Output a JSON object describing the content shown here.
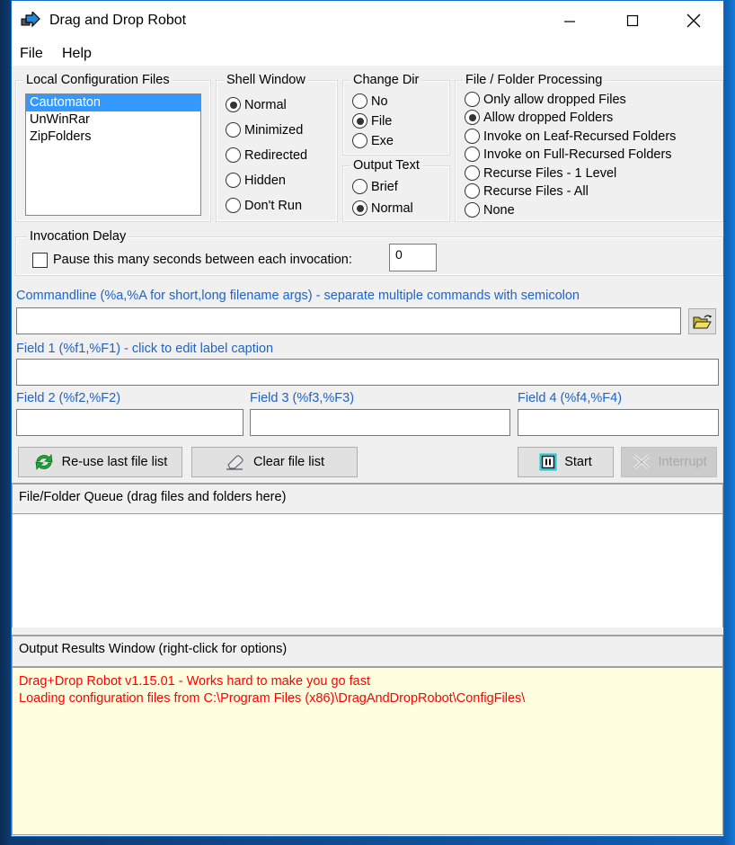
{
  "window": {
    "title": "Drag and Drop Robot",
    "controls": {
      "minimize": "–",
      "maximize": "☐",
      "close": "✕"
    }
  },
  "menu": [
    "File",
    "Help"
  ],
  "config_files": {
    "label": "Local Configuration Files",
    "items": [
      "Cautomaton",
      "UnWinRar",
      "ZipFolders"
    ],
    "selected": "Cautomaton"
  },
  "shell_window": {
    "label": "Shell Window",
    "options": [
      "Normal",
      "Minimized",
      "Redirected",
      "Hidden",
      "Don't Run"
    ],
    "selected": "Normal"
  },
  "change_dir": {
    "label": "Change Dir",
    "options": [
      "No",
      "File",
      "Exe"
    ],
    "selected": "File"
  },
  "output_text": {
    "label": "Output Text",
    "options": [
      "Brief",
      "Normal"
    ],
    "selected": "Normal"
  },
  "file_folder_processing": {
    "label": "File / Folder Processing",
    "options": [
      "Only allow dropped Files",
      "Allow dropped Folders",
      "Invoke on Leaf-Recursed Folders",
      "Invoke on Full-Recursed Folders",
      "Recurse Files - 1 Level",
      "Recurse Files - All",
      "None"
    ],
    "selected": "Allow dropped Folders"
  },
  "invocation_delay": {
    "label": "Invocation Delay",
    "checkbox_label": "Pause this many seconds between each invocation:",
    "checked": false,
    "value": "0"
  },
  "commandline": {
    "label": "Commandline (%a,%A for short,long filename args) - separate multiple commands with semicolon",
    "value": ""
  },
  "fields": [
    {
      "label": "Field 1 (%f1,%F1) - click to edit label caption",
      "value": ""
    },
    {
      "label": "Field 2 (%f2,%F2)",
      "value": ""
    },
    {
      "label": "Field 3 (%f3,%F3)",
      "value": ""
    },
    {
      "label": "Field 4 (%f4,%F4)",
      "value": ""
    }
  ],
  "buttons": {
    "reuse": "Re-use last file list",
    "clear": "Clear file list",
    "start": "Start",
    "interrupt": "Interrupt"
  },
  "queue": {
    "header": "File/Folder Queue (drag files and folders here)"
  },
  "output": {
    "header": "Output Results Window (right-click for options)",
    "lines": [
      "Drag+Drop Robot v1.15.01 - Works hard to make you go fast",
      "Loading configuration files from C:\\Program Files (x86)\\DragAndDropRobot\\ConfigFiles\\"
    ]
  },
  "colors": {
    "selection": "#3399ff",
    "label_blue": "#1e64c8",
    "output_text": "#ff0000",
    "output_bg": "#ffffe0"
  }
}
